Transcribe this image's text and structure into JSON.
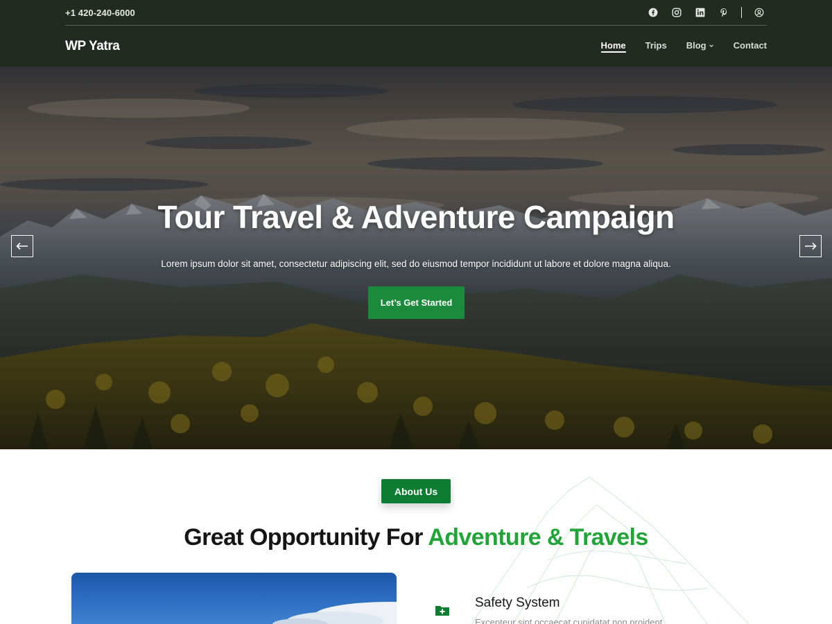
{
  "header": {
    "phone": "+1 420-240-6000",
    "logo": "WP Yatra",
    "social_icons": [
      "facebook-icon",
      "instagram-icon",
      "linkedin-icon",
      "pinterest-icon",
      "user-account-icon"
    ],
    "nav": [
      {
        "label": "Home",
        "active": true
      },
      {
        "label": "Trips",
        "active": false
      },
      {
        "label": "Blog",
        "active": false,
        "has_dropdown": true
      },
      {
        "label": "Contact",
        "active": false
      }
    ]
  },
  "hero": {
    "title": "Tour Travel & Adventure Campaign",
    "subtitle": "Lorem ipsum dolor sit amet, consectetur adipiscing elit, sed do eiusmod tempor incididunt ut labore et dolore magna aliqua.",
    "cta_label": "Let’s Get Started",
    "prev_icon": "arrow-left-icon",
    "next_icon": "arrow-right-icon"
  },
  "about": {
    "badge": "About Us",
    "title_main": "Great Opportunity For ",
    "title_accent": "Adventure & Travels",
    "feature": {
      "icon": "medical-folder-icon",
      "title": "Safety System",
      "text": "Excepteur sint occaecat cupidatat non proident"
    }
  },
  "colors": {
    "header_bg": "#212b21",
    "accent_green": "#1b8a3c",
    "title_accent": "#24a33a"
  }
}
